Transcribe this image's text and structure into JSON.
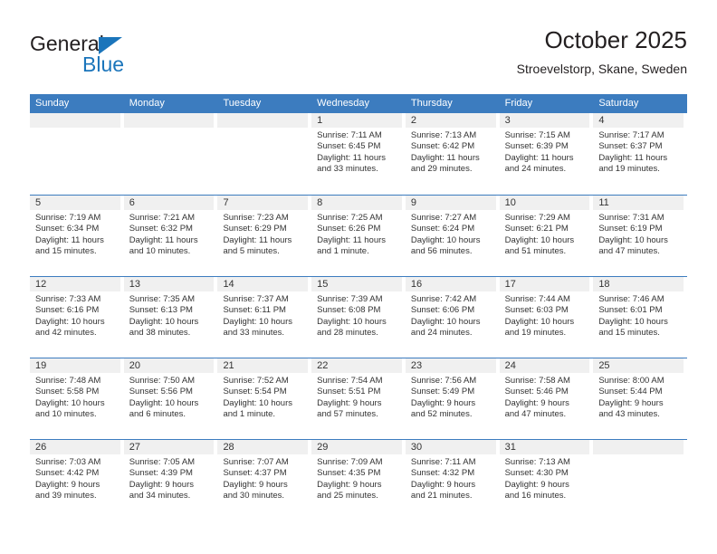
{
  "logo": {
    "word_top": "General",
    "word_bottom": "Blue",
    "triangle_color": "#1b75bb",
    "text_color": "#231f20"
  },
  "header": {
    "title": "October 2025",
    "subtitle": "Stroevelstorp, Skane, Sweden"
  },
  "colors": {
    "header_blue": "#3c7cbf",
    "day_band_gray": "#f0f0f0",
    "text": "#333333"
  },
  "calendar": {
    "weekdays": [
      "Sunday",
      "Monday",
      "Tuesday",
      "Wednesday",
      "Thursday",
      "Friday",
      "Saturday"
    ],
    "weeks": [
      [
        {
          "day": "",
          "empty": true
        },
        {
          "day": "",
          "empty": true
        },
        {
          "day": "",
          "empty": true
        },
        {
          "day": "1",
          "sunrise": "Sunrise: 7:11 AM",
          "sunset": "Sunset: 6:45 PM",
          "daylight_1": "Daylight: 11 hours",
          "daylight_2": "and 33 minutes."
        },
        {
          "day": "2",
          "sunrise": "Sunrise: 7:13 AM",
          "sunset": "Sunset: 6:42 PM",
          "daylight_1": "Daylight: 11 hours",
          "daylight_2": "and 29 minutes."
        },
        {
          "day": "3",
          "sunrise": "Sunrise: 7:15 AM",
          "sunset": "Sunset: 6:39 PM",
          "daylight_1": "Daylight: 11 hours",
          "daylight_2": "and 24 minutes."
        },
        {
          "day": "4",
          "sunrise": "Sunrise: 7:17 AM",
          "sunset": "Sunset: 6:37 PM",
          "daylight_1": "Daylight: 11 hours",
          "daylight_2": "and 19 minutes."
        }
      ],
      [
        {
          "day": "5",
          "sunrise": "Sunrise: 7:19 AM",
          "sunset": "Sunset: 6:34 PM",
          "daylight_1": "Daylight: 11 hours",
          "daylight_2": "and 15 minutes."
        },
        {
          "day": "6",
          "sunrise": "Sunrise: 7:21 AM",
          "sunset": "Sunset: 6:32 PM",
          "daylight_1": "Daylight: 11 hours",
          "daylight_2": "and 10 minutes."
        },
        {
          "day": "7",
          "sunrise": "Sunrise: 7:23 AM",
          "sunset": "Sunset: 6:29 PM",
          "daylight_1": "Daylight: 11 hours",
          "daylight_2": "and 5 minutes."
        },
        {
          "day": "8",
          "sunrise": "Sunrise: 7:25 AM",
          "sunset": "Sunset: 6:26 PM",
          "daylight_1": "Daylight: 11 hours",
          "daylight_2": "and 1 minute."
        },
        {
          "day": "9",
          "sunrise": "Sunrise: 7:27 AM",
          "sunset": "Sunset: 6:24 PM",
          "daylight_1": "Daylight: 10 hours",
          "daylight_2": "and 56 minutes."
        },
        {
          "day": "10",
          "sunrise": "Sunrise: 7:29 AM",
          "sunset": "Sunset: 6:21 PM",
          "daylight_1": "Daylight: 10 hours",
          "daylight_2": "and 51 minutes."
        },
        {
          "day": "11",
          "sunrise": "Sunrise: 7:31 AM",
          "sunset": "Sunset: 6:19 PM",
          "daylight_1": "Daylight: 10 hours",
          "daylight_2": "and 47 minutes."
        }
      ],
      [
        {
          "day": "12",
          "sunrise": "Sunrise: 7:33 AM",
          "sunset": "Sunset: 6:16 PM",
          "daylight_1": "Daylight: 10 hours",
          "daylight_2": "and 42 minutes."
        },
        {
          "day": "13",
          "sunrise": "Sunrise: 7:35 AM",
          "sunset": "Sunset: 6:13 PM",
          "daylight_1": "Daylight: 10 hours",
          "daylight_2": "and 38 minutes."
        },
        {
          "day": "14",
          "sunrise": "Sunrise: 7:37 AM",
          "sunset": "Sunset: 6:11 PM",
          "daylight_1": "Daylight: 10 hours",
          "daylight_2": "and 33 minutes."
        },
        {
          "day": "15",
          "sunrise": "Sunrise: 7:39 AM",
          "sunset": "Sunset: 6:08 PM",
          "daylight_1": "Daylight: 10 hours",
          "daylight_2": "and 28 minutes."
        },
        {
          "day": "16",
          "sunrise": "Sunrise: 7:42 AM",
          "sunset": "Sunset: 6:06 PM",
          "daylight_1": "Daylight: 10 hours",
          "daylight_2": "and 24 minutes."
        },
        {
          "day": "17",
          "sunrise": "Sunrise: 7:44 AM",
          "sunset": "Sunset: 6:03 PM",
          "daylight_1": "Daylight: 10 hours",
          "daylight_2": "and 19 minutes."
        },
        {
          "day": "18",
          "sunrise": "Sunrise: 7:46 AM",
          "sunset": "Sunset: 6:01 PM",
          "daylight_1": "Daylight: 10 hours",
          "daylight_2": "and 15 minutes."
        }
      ],
      [
        {
          "day": "19",
          "sunrise": "Sunrise: 7:48 AM",
          "sunset": "Sunset: 5:58 PM",
          "daylight_1": "Daylight: 10 hours",
          "daylight_2": "and 10 minutes."
        },
        {
          "day": "20",
          "sunrise": "Sunrise: 7:50 AM",
          "sunset": "Sunset: 5:56 PM",
          "daylight_1": "Daylight: 10 hours",
          "daylight_2": "and 6 minutes."
        },
        {
          "day": "21",
          "sunrise": "Sunrise: 7:52 AM",
          "sunset": "Sunset: 5:54 PM",
          "daylight_1": "Daylight: 10 hours",
          "daylight_2": "and 1 minute."
        },
        {
          "day": "22",
          "sunrise": "Sunrise: 7:54 AM",
          "sunset": "Sunset: 5:51 PM",
          "daylight_1": "Daylight: 9 hours",
          "daylight_2": "and 57 minutes."
        },
        {
          "day": "23",
          "sunrise": "Sunrise: 7:56 AM",
          "sunset": "Sunset: 5:49 PM",
          "daylight_1": "Daylight: 9 hours",
          "daylight_2": "and 52 minutes."
        },
        {
          "day": "24",
          "sunrise": "Sunrise: 7:58 AM",
          "sunset": "Sunset: 5:46 PM",
          "daylight_1": "Daylight: 9 hours",
          "daylight_2": "and 47 minutes."
        },
        {
          "day": "25",
          "sunrise": "Sunrise: 8:00 AM",
          "sunset": "Sunset: 5:44 PM",
          "daylight_1": "Daylight: 9 hours",
          "daylight_2": "and 43 minutes."
        }
      ],
      [
        {
          "day": "26",
          "sunrise": "Sunrise: 7:03 AM",
          "sunset": "Sunset: 4:42 PM",
          "daylight_1": "Daylight: 9 hours",
          "daylight_2": "and 39 minutes."
        },
        {
          "day": "27",
          "sunrise": "Sunrise: 7:05 AM",
          "sunset": "Sunset: 4:39 PM",
          "daylight_1": "Daylight: 9 hours",
          "daylight_2": "and 34 minutes."
        },
        {
          "day": "28",
          "sunrise": "Sunrise: 7:07 AM",
          "sunset": "Sunset: 4:37 PM",
          "daylight_1": "Daylight: 9 hours",
          "daylight_2": "and 30 minutes."
        },
        {
          "day": "29",
          "sunrise": "Sunrise: 7:09 AM",
          "sunset": "Sunset: 4:35 PM",
          "daylight_1": "Daylight: 9 hours",
          "daylight_2": "and 25 minutes."
        },
        {
          "day": "30",
          "sunrise": "Sunrise: 7:11 AM",
          "sunset": "Sunset: 4:32 PM",
          "daylight_1": "Daylight: 9 hours",
          "daylight_2": "and 21 minutes."
        },
        {
          "day": "31",
          "sunrise": "Sunrise: 7:13 AM",
          "sunset": "Sunset: 4:30 PM",
          "daylight_1": "Daylight: 9 hours",
          "daylight_2": "and 16 minutes."
        },
        {
          "day": "",
          "empty": true
        }
      ]
    ]
  }
}
